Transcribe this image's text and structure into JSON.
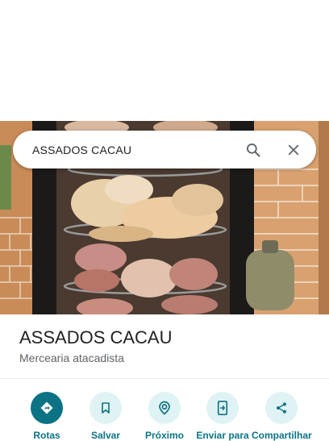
{
  "search": {
    "query": "ASSADOS CACAU",
    "search_icon": "search-icon",
    "close_icon": "close-icon"
  },
  "place": {
    "name": "ASSADOS CACAU",
    "category": "Mercearia atacadista"
  },
  "actions": [
    {
      "label": "Rotas",
      "icon": "directions-icon"
    },
    {
      "label": "Salvar",
      "icon": "bookmark-icon"
    },
    {
      "label": "Próximo",
      "icon": "nearby-icon"
    },
    {
      "label": "Enviar para",
      "icon": "send-to-phone-icon"
    },
    {
      "label": "Compartilhar",
      "icon": "share-icon"
    }
  ],
  "colors": {
    "accent": "#0b7384",
    "accent_light": "#e0f3f4",
    "title": "#202124",
    "subtitle": "#5f6368"
  }
}
